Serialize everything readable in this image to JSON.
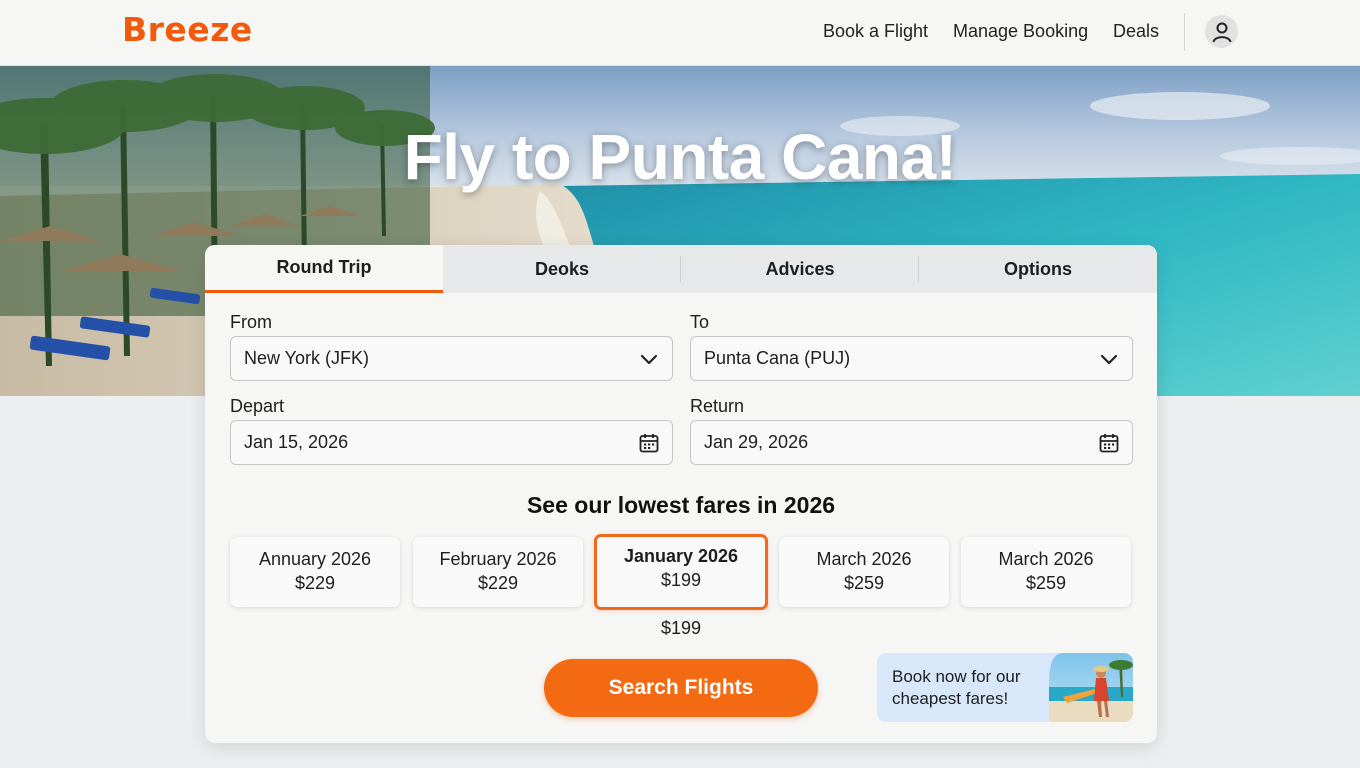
{
  "header": {
    "logo": "Breeze",
    "nav": [
      "Book a Flight",
      "Manage Booking",
      "Deals"
    ]
  },
  "hero": {
    "title": "Fly to Punta Cana!"
  },
  "tabs": [
    "Round Trip",
    "Deoks",
    "Advices",
    "Options"
  ],
  "form": {
    "from_label": "From",
    "from_value": "New York (JFK)",
    "to_label": "To",
    "to_value": "Punta Cana (PUJ)",
    "depart_label": "Depart",
    "depart_value": "Jan 15, 2026",
    "return_label": "Return",
    "return_value": "Jan 29, 2026"
  },
  "fares": {
    "title": "See our lowest fares in 2026",
    "items": [
      {
        "month": "Annuary 2026",
        "price": "$229"
      },
      {
        "month": "February 2026",
        "price": "$229"
      },
      {
        "month": "January 2026",
        "price": "$199",
        "selected": true
      },
      {
        "month": "March 2026",
        "price": "$259"
      },
      {
        "month": "March 2026",
        "price": "$259"
      }
    ],
    "selected_price": "$199"
  },
  "search_button": "Search Flights",
  "promo": {
    "text": "Book now for our cheapest fares!"
  },
  "colors": {
    "brand": "#f15a0c",
    "button": "#f36a12",
    "promo_bg": "#d9e7fb"
  },
  "icons": [
    "user-icon",
    "chevron-down-icon",
    "calendar-icon"
  ]
}
